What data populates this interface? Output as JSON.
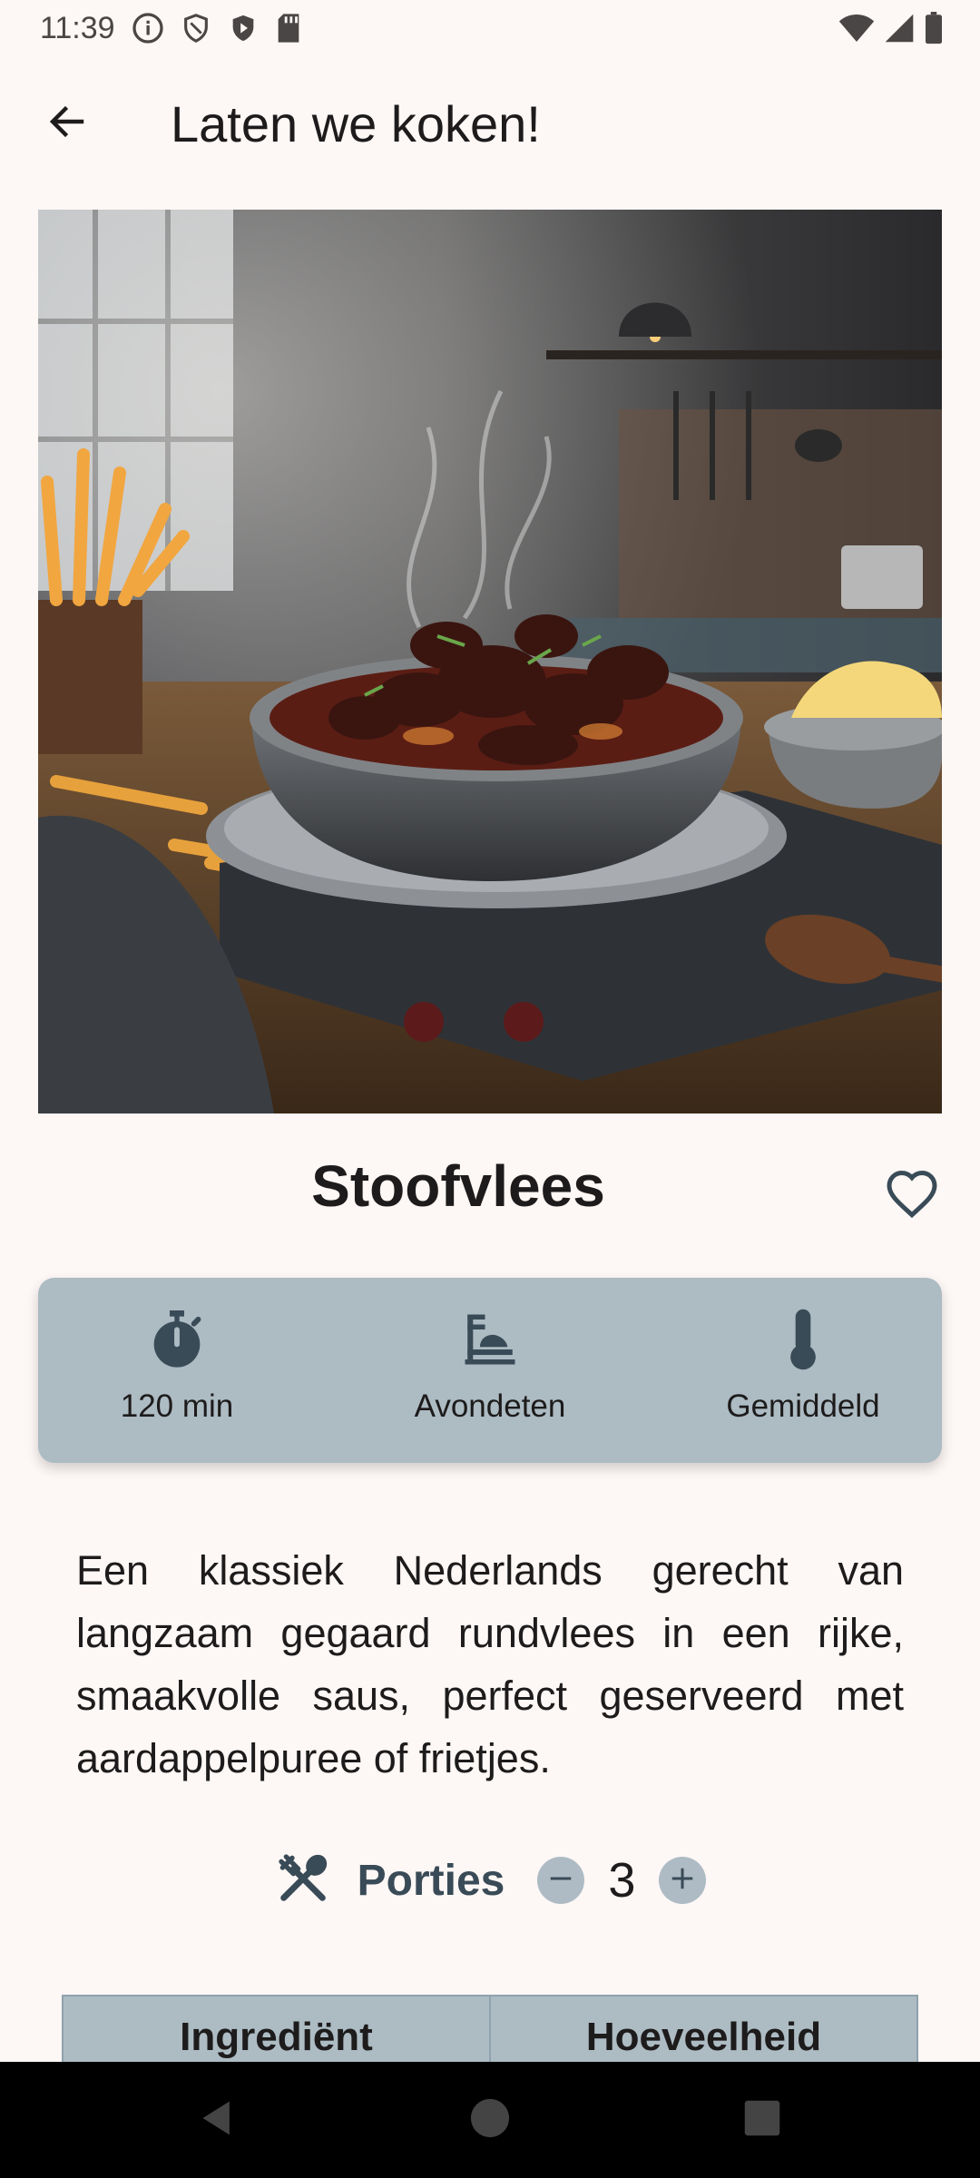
{
  "status_bar": {
    "time": "11:39",
    "icons": [
      "info-icon",
      "shield-outline-icon",
      "shield-play-icon",
      "sd-card-icon",
      "wifi-icon",
      "cellular-icon",
      "battery-icon"
    ]
  },
  "app_bar": {
    "title": "Laten we koken!",
    "back_icon": "arrow-back-icon"
  },
  "recipe": {
    "title": "Stoofvlees",
    "favorite_icon": "heart-outline-icon",
    "image_subject": "beef stew with fries and mashed potatoes"
  },
  "info": {
    "time_label": "120 min",
    "time_icon": "timer-icon",
    "meal_label": "Avondeten",
    "meal_icon": "dinner-icon",
    "difficulty_label": "Gemiddeld",
    "difficulty_icon": "thermometer-icon"
  },
  "description": "Een klassiek Nederlands gerecht van langzaam gegaard rundvlees in een rijke, smaakvolle saus, perfect geserveerd met aardappelpuree of frietjes.",
  "portions": {
    "label": "Porties",
    "count": "3",
    "icon": "utensils-icon"
  },
  "ingredients_table": {
    "headers": [
      "Ingrediënt",
      "Hoeveelheid"
    ]
  },
  "colors": {
    "background": "#fdf7f5",
    "card": "#adbbc3",
    "accent": "#394b57"
  }
}
